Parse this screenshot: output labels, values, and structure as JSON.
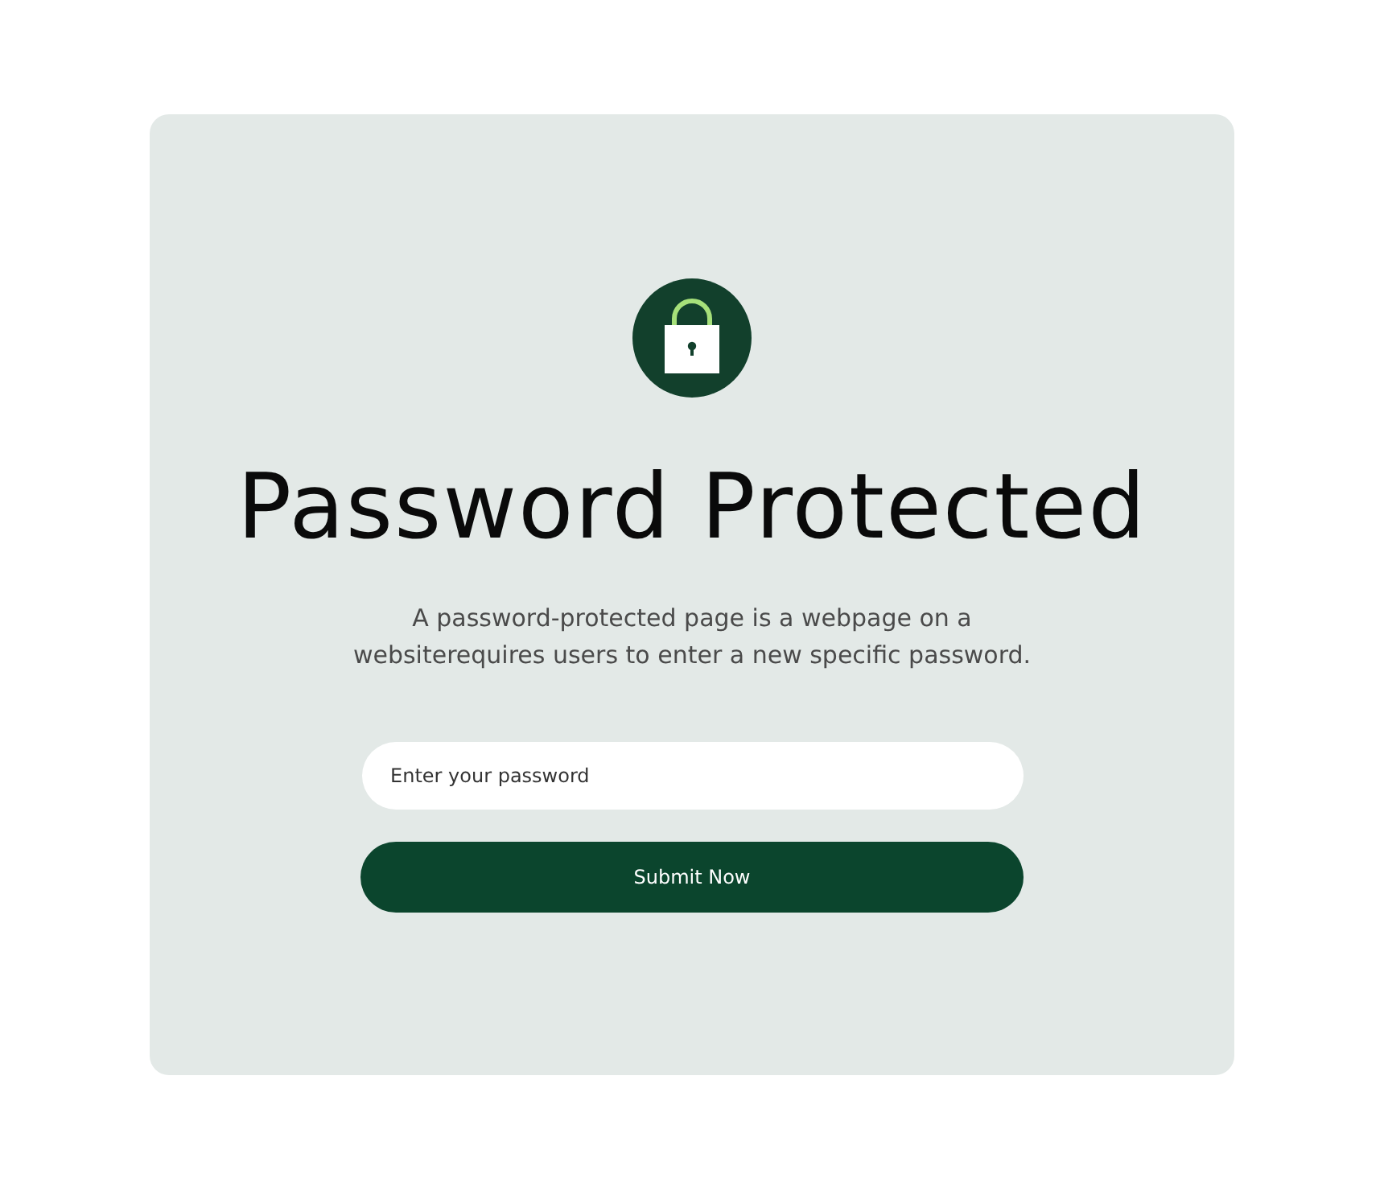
{
  "title": "Password Protected",
  "description": "A password-protected page is a webpage on a websiterequires users to enter a new specific password.",
  "password_field": {
    "placeholder": "Enter your password"
  },
  "submit_button": {
    "label": "Submit Now"
  }
}
